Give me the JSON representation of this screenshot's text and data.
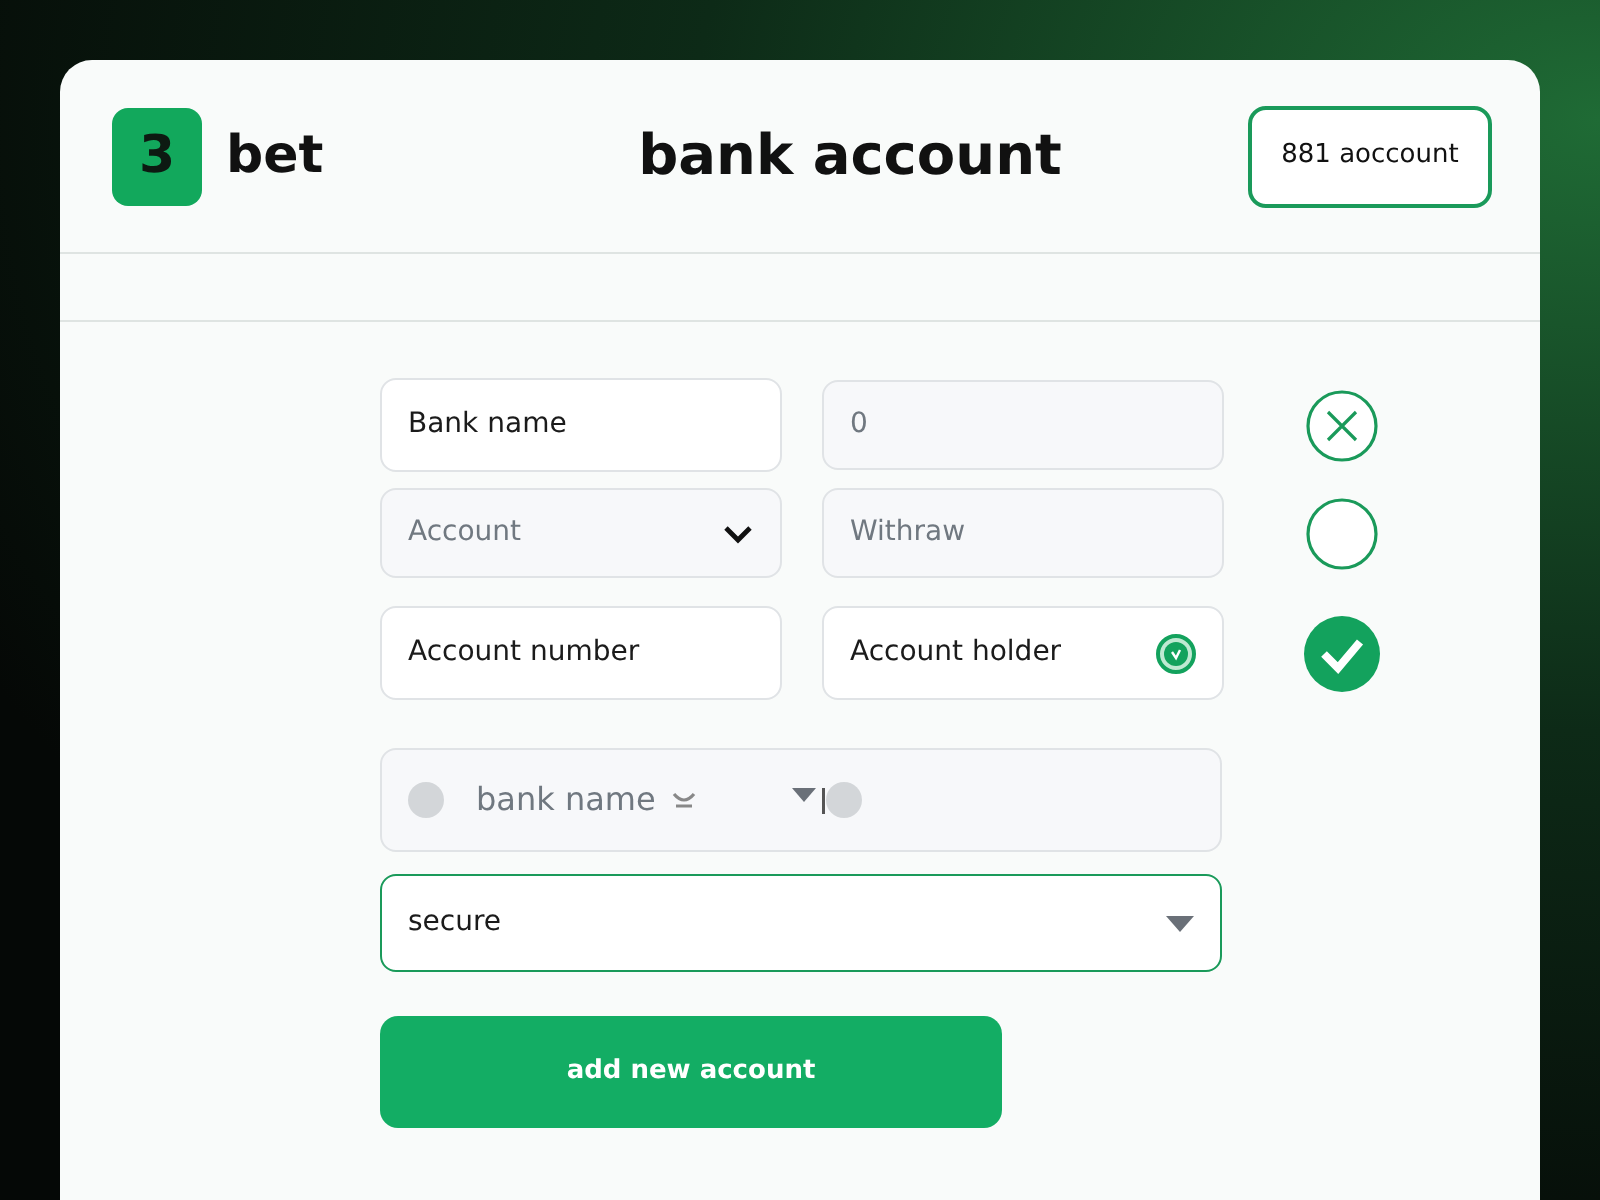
{
  "header": {
    "logo": "3",
    "brand": "bet",
    "title": "bank account",
    "account_button": "881 aoccount"
  },
  "form_rows": [
    {
      "error": true,
      "valid": false,
      "fields": [
        {
          "kind": "input",
          "value": "Bank name",
          "verified": false
        },
        {
          "kind": "input",
          "placeholder": "0",
          "verified": false
        }
      ]
    },
    {
      "error": false,
      "valid": false,
      "fields": [
        {
          "kind": "select",
          "placeholder": "Account",
          "verified": false
        },
        {
          "kind": "input",
          "placeholder": "Withraw",
          "verified": false
        }
      ]
    },
    {
      "error": false,
      "valid": true,
      "fields": [
        {
          "kind": "input",
          "value": "Account number",
          "verified": false
        },
        {
          "kind": "input",
          "value": "Account holder",
          "verified": true
        }
      ]
    }
  ],
  "wide_fields": [
    {
      "kind": "combo",
      "placeholder": "bank name",
      "focused": false
    },
    {
      "kind": "select",
      "value": "secure",
      "focused": true
    }
  ],
  "submit_button": "add new account"
}
